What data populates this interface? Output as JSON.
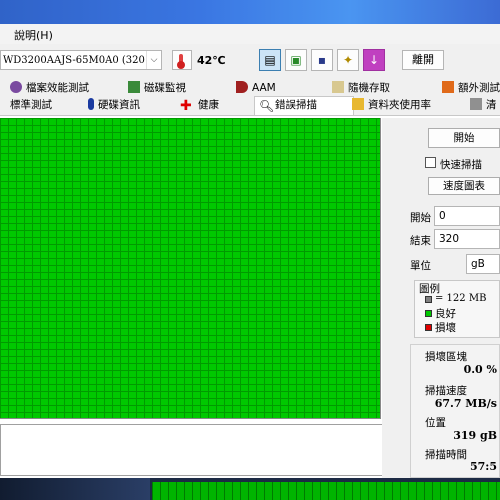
{
  "menu": {
    "help_label": "說明(H)"
  },
  "toolbar": {
    "drive": "WD3200AAJS-65M0A0 (320 gB)",
    "temperature": "42℃",
    "exit_label": "離開",
    "icons": [
      "copy-text-icon",
      "copy-screenshot-icon",
      "save-icon",
      "options-icon",
      "download-icon"
    ]
  },
  "tabs_row1": [
    "檔案效能測試",
    "磁碟監視",
    "AAM",
    "隨機存取",
    "額外測試"
  ],
  "tabs_row2": [
    "標準測試",
    "硬碟資訊",
    "健康",
    "錯誤掃描",
    "資料夾使用率",
    "清"
  ],
  "selected_tab": "錯誤掃描",
  "scan": {
    "start_label": "開始",
    "quick_scan_label": "快速掃描",
    "speed_map_label": "速度圖表",
    "start_field_label": "開始",
    "start_value": "0",
    "end_field_label": "結束",
    "end_value": "320",
    "unit_label": "單位",
    "unit_value": "gB"
  },
  "legend": {
    "title": "圖例",
    "block_size": "= 122 MB",
    "good": "良好",
    "bad": "損壞",
    "colors": {
      "good": "#00c800",
      "bad": "#e00000",
      "block": "#808080"
    }
  },
  "stats": {
    "damaged_label": "損壞區塊",
    "damaged_value": "0.0 %",
    "speed_label": "掃描速度",
    "speed_value": "67.7 MB/s",
    "position_label": "位置",
    "position_value": "319 gB",
    "time_label": "掃描時間",
    "time_value": "57:5"
  }
}
